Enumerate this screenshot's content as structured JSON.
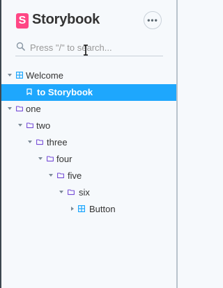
{
  "header": {
    "logo_letter": "S",
    "brand": "Storybook",
    "menu_icon": "ellipsis-icon",
    "menu_label": "•••"
  },
  "search": {
    "placeholder": "Press \"/\" to search...",
    "value": ""
  },
  "colors": {
    "brand": "#ff4785",
    "selected": "#1ea7fd",
    "component_icon": "#1ea7fd",
    "folder_icon": "#774dd7"
  },
  "tree": [
    {
      "label": "Welcome",
      "type": "component",
      "expanded": true
    },
    {
      "label": "to Storybook",
      "type": "story",
      "selected": true
    },
    {
      "label": "one",
      "type": "folder",
      "expanded": true
    },
    {
      "label": "two",
      "type": "folder",
      "expanded": true
    },
    {
      "label": "three",
      "type": "folder",
      "expanded": true
    },
    {
      "label": "four",
      "type": "folder",
      "expanded": true
    },
    {
      "label": "five",
      "type": "folder",
      "expanded": true
    },
    {
      "label": "six",
      "type": "folder",
      "expanded": true
    },
    {
      "label": "Button",
      "type": "component",
      "expanded": false
    }
  ]
}
